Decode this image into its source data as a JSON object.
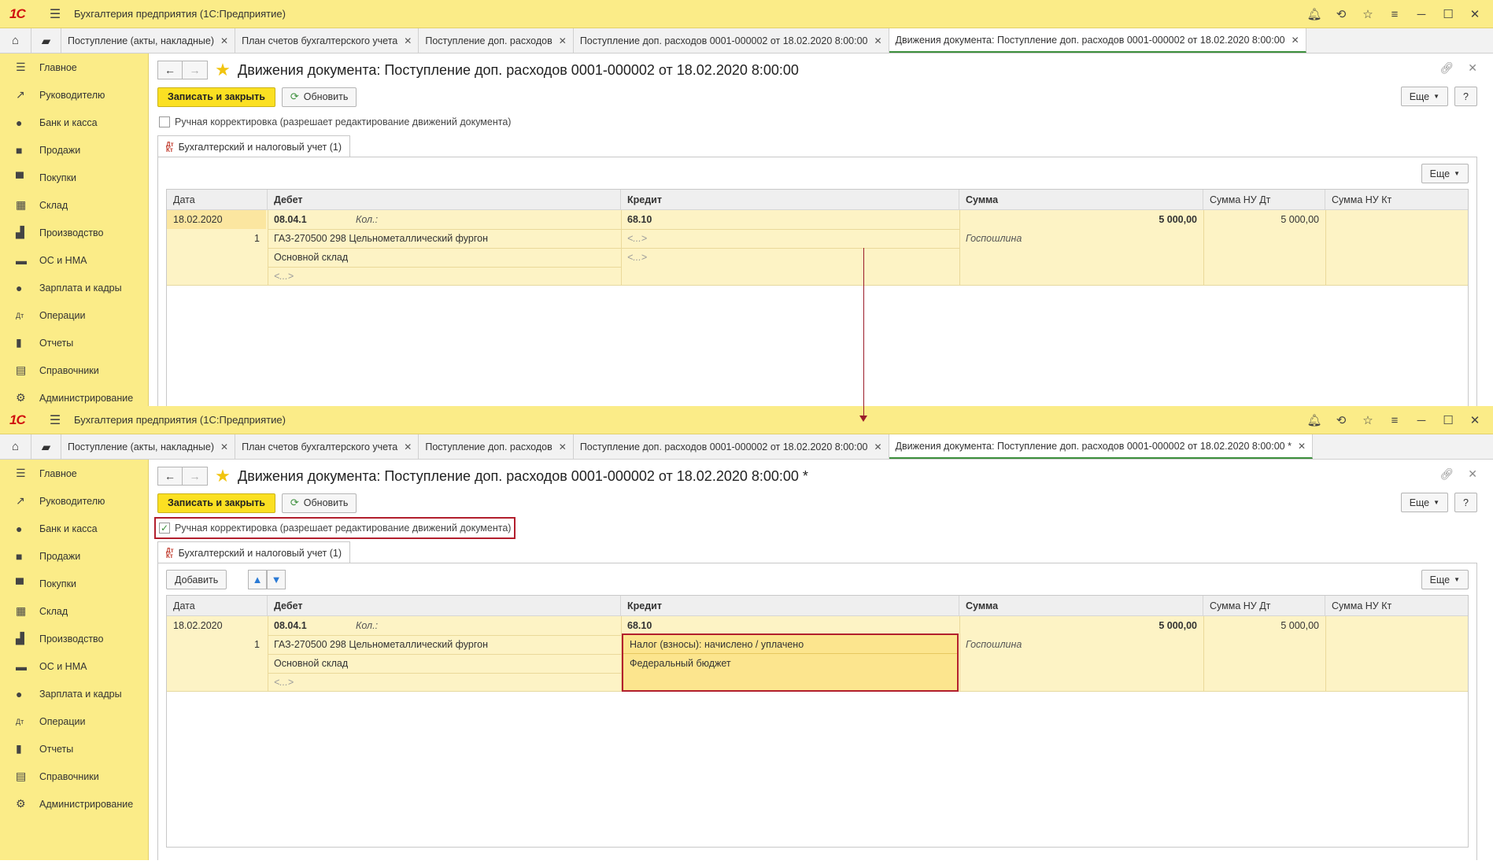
{
  "app": {
    "logo": "1С",
    "title": "Бухгалтерия предприятия (1С:Предприятие)"
  },
  "tabs": [
    {
      "label": "Поступление (акты, накладные)"
    },
    {
      "label": "План счетов бухгалтерского учета"
    },
    {
      "label": "Поступление доп. расходов"
    },
    {
      "label": "Поступление доп. расходов 0001-000002 от 18.02.2020 8:00:00"
    },
    {
      "label": "Движения документа: Поступление доп. расходов 0001-000002 от 18.02.2020 8:00:00"
    }
  ],
  "tabs_after": {
    "active_label": "Движения документа: Поступление доп. расходов 0001-000002 от 18.02.2020 8:00:00 *"
  },
  "sidebar": [
    {
      "label": "Главное",
      "icon": "menu-icon"
    },
    {
      "label": "Руководителю",
      "icon": "trend-icon"
    },
    {
      "label": "Банк и касса",
      "icon": "coin-icon"
    },
    {
      "label": "Продажи",
      "icon": "bag-icon"
    },
    {
      "label": "Покупки",
      "icon": "cart-icon"
    },
    {
      "label": "Склад",
      "icon": "grid-icon"
    },
    {
      "label": "Производство",
      "icon": "factory-icon"
    },
    {
      "label": "ОС и НМА",
      "icon": "truck-icon"
    },
    {
      "label": "Зарплата и кадры",
      "icon": "person-icon"
    },
    {
      "label": "Операции",
      "icon": "dtkt-icon"
    },
    {
      "label": "Отчеты",
      "icon": "barchart-icon"
    },
    {
      "label": "Справочники",
      "icon": "book-icon"
    },
    {
      "label": "Администрирование",
      "icon": "gear-icon"
    }
  ],
  "form": {
    "title": "Движения документа: Поступление доп. расходов 0001-000002 от 18.02.2020 8:00:00",
    "title_modified": "Движения документа: Поступление доп. расходов 0001-000002 от 18.02.2020 8:00:00 *",
    "save_close": "Записать и закрыть",
    "refresh": "Обновить",
    "more": "Еще",
    "help": "?",
    "manual_checkbox": "Ручная корректировка (разрешает редактирование движений документа)",
    "subtab": "Бухгалтерский и налоговый учет (1)",
    "subtab_icon": "Дт Кт",
    "add": "Добавить"
  },
  "grid": {
    "columns": [
      "Дата",
      "Дебет",
      "Кредит",
      "Сумма",
      "Сумма НУ Дт",
      "Сумма НУ Кт"
    ],
    "row": {
      "date": "18.02.2020",
      "number": "1",
      "debit_account": "08.04.1",
      "qty_label": "Кол.:",
      "debit_sub1": "ГАЗ-270500 298 Цельнометаллический фургон",
      "debit_sub2": "Основной склад",
      "debit_sub3": "<...>",
      "credit_account": "68.10",
      "credit_sub1_before": "<...>",
      "credit_sub2_before": "<...>",
      "credit_sub1_after": "Налог (взносы): начислено / уплачено",
      "credit_sub2_after": "Федеральный бюджет",
      "amount": "5 000,00",
      "content": "Госпошлина",
      "nu_dt": "5 000,00",
      "nu_kt": ""
    }
  },
  "colors": {
    "accent_yellow": "#fbec88",
    "highlight_red": "#b21f2d",
    "active_tab_green": "#3c8f3c"
  }
}
